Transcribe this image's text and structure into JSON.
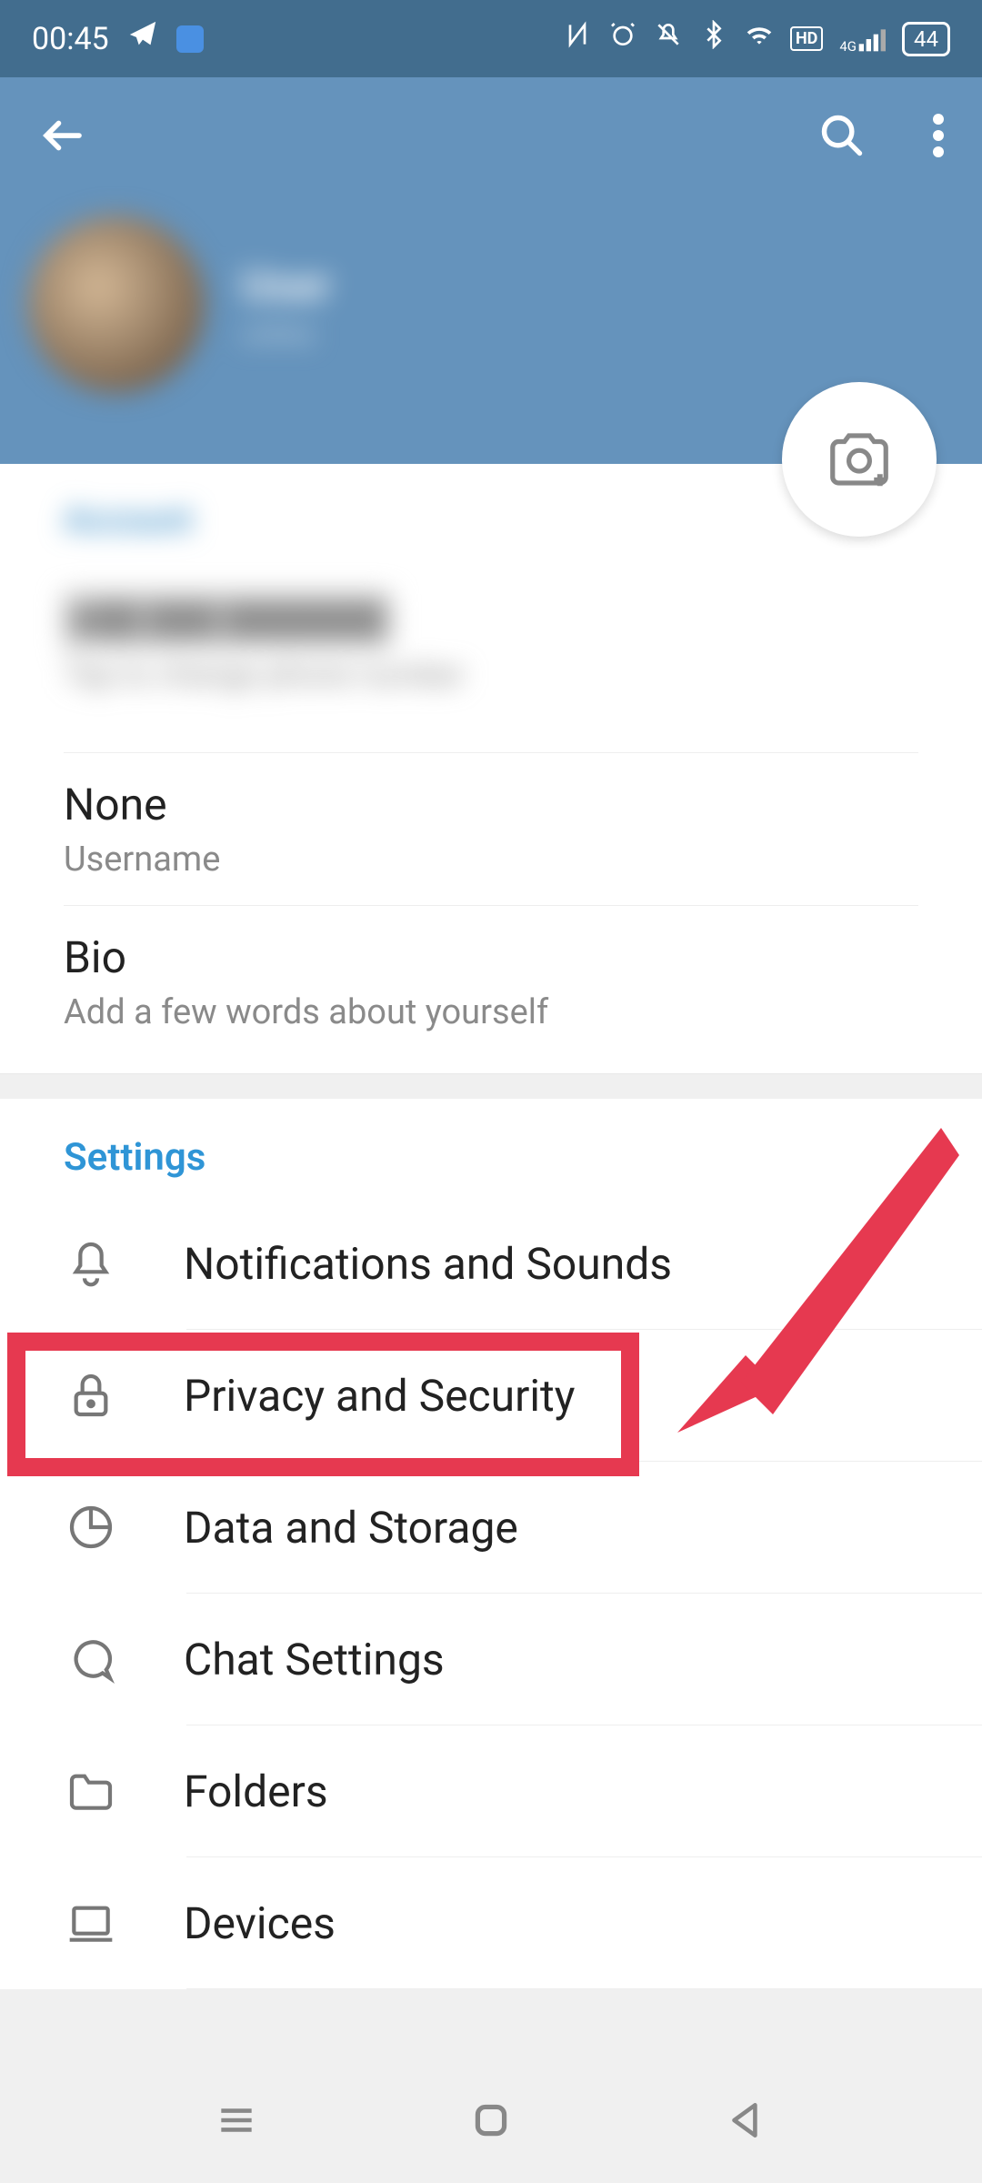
{
  "status": {
    "time": "00:45",
    "battery": "44"
  },
  "profile": {
    "name": "User",
    "status": "online"
  },
  "account": {
    "heading": "Account",
    "phone": "+00 000 0000000",
    "phone_hint": "Tap to change phone number",
    "username_value": "None",
    "username_label": "Username",
    "bio_value": "Bio",
    "bio_hint": "Add a few words about yourself"
  },
  "settings": {
    "heading": "Settings",
    "items": [
      {
        "label": "Notifications and Sounds"
      },
      {
        "label": "Privacy and Security"
      },
      {
        "label": "Data and Storage"
      },
      {
        "label": "Chat Settings"
      },
      {
        "label": "Folders"
      },
      {
        "label": "Devices"
      }
    ]
  }
}
